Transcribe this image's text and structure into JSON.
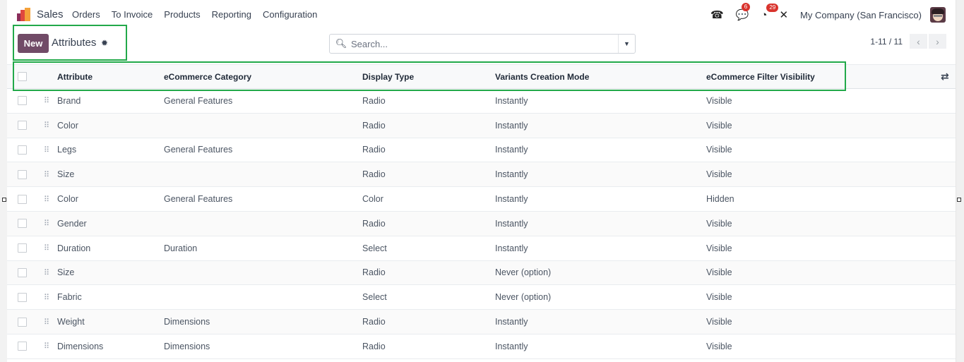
{
  "navbar": {
    "app_name": "Sales",
    "menu": [
      "Orders",
      "To Invoice",
      "Products",
      "Reporting",
      "Configuration"
    ],
    "icons": {
      "phone": "phone-icon",
      "messages": "chat-icon",
      "activities": "clock-icon",
      "debug": "tools-icon"
    },
    "messages_badge": "6",
    "activities_badge": "29",
    "company": "My Company (San Francisco)"
  },
  "control_panel": {
    "new_label": "New",
    "breadcrumb": "Attributes",
    "search_placeholder": "Search...",
    "pager_value": "1-11 / 11"
  },
  "table": {
    "columns": [
      "Attribute",
      "eCommerce Category",
      "Display Type",
      "Variants Creation Mode",
      "eCommerce Filter Visibility"
    ],
    "rows": [
      {
        "attribute": "Brand",
        "category": "General Features",
        "display_type": "Radio",
        "variants_mode": "Instantly",
        "visibility": "Visible"
      },
      {
        "attribute": "Color",
        "category": "",
        "display_type": "Radio",
        "variants_mode": "Instantly",
        "visibility": "Visible"
      },
      {
        "attribute": "Legs",
        "category": "General Features",
        "display_type": "Radio",
        "variants_mode": "Instantly",
        "visibility": "Visible"
      },
      {
        "attribute": "Size",
        "category": "",
        "display_type": "Radio",
        "variants_mode": "Instantly",
        "visibility": "Visible"
      },
      {
        "attribute": "Color",
        "category": "General Features",
        "display_type": "Color",
        "variants_mode": "Instantly",
        "visibility": "Hidden"
      },
      {
        "attribute": "Gender",
        "category": "",
        "display_type": "Radio",
        "variants_mode": "Instantly",
        "visibility": "Visible"
      },
      {
        "attribute": "Duration",
        "category": "Duration",
        "display_type": "Select",
        "variants_mode": "Instantly",
        "visibility": "Visible"
      },
      {
        "attribute": "Size",
        "category": "",
        "display_type": "Radio",
        "variants_mode": "Never (option)",
        "visibility": "Visible"
      },
      {
        "attribute": "Fabric",
        "category": "",
        "display_type": "Select",
        "variants_mode": "Never (option)",
        "visibility": "Visible"
      },
      {
        "attribute": "Weight",
        "category": "Dimensions",
        "display_type": "Radio",
        "variants_mode": "Instantly",
        "visibility": "Visible"
      },
      {
        "attribute": "Dimensions",
        "category": "Dimensions",
        "display_type": "Radio",
        "variants_mode": "Instantly",
        "visibility": "Visible"
      }
    ]
  },
  "colors": {
    "brand": "#714b67",
    "badge": "#d9332d",
    "highlight": "#22a94a"
  }
}
